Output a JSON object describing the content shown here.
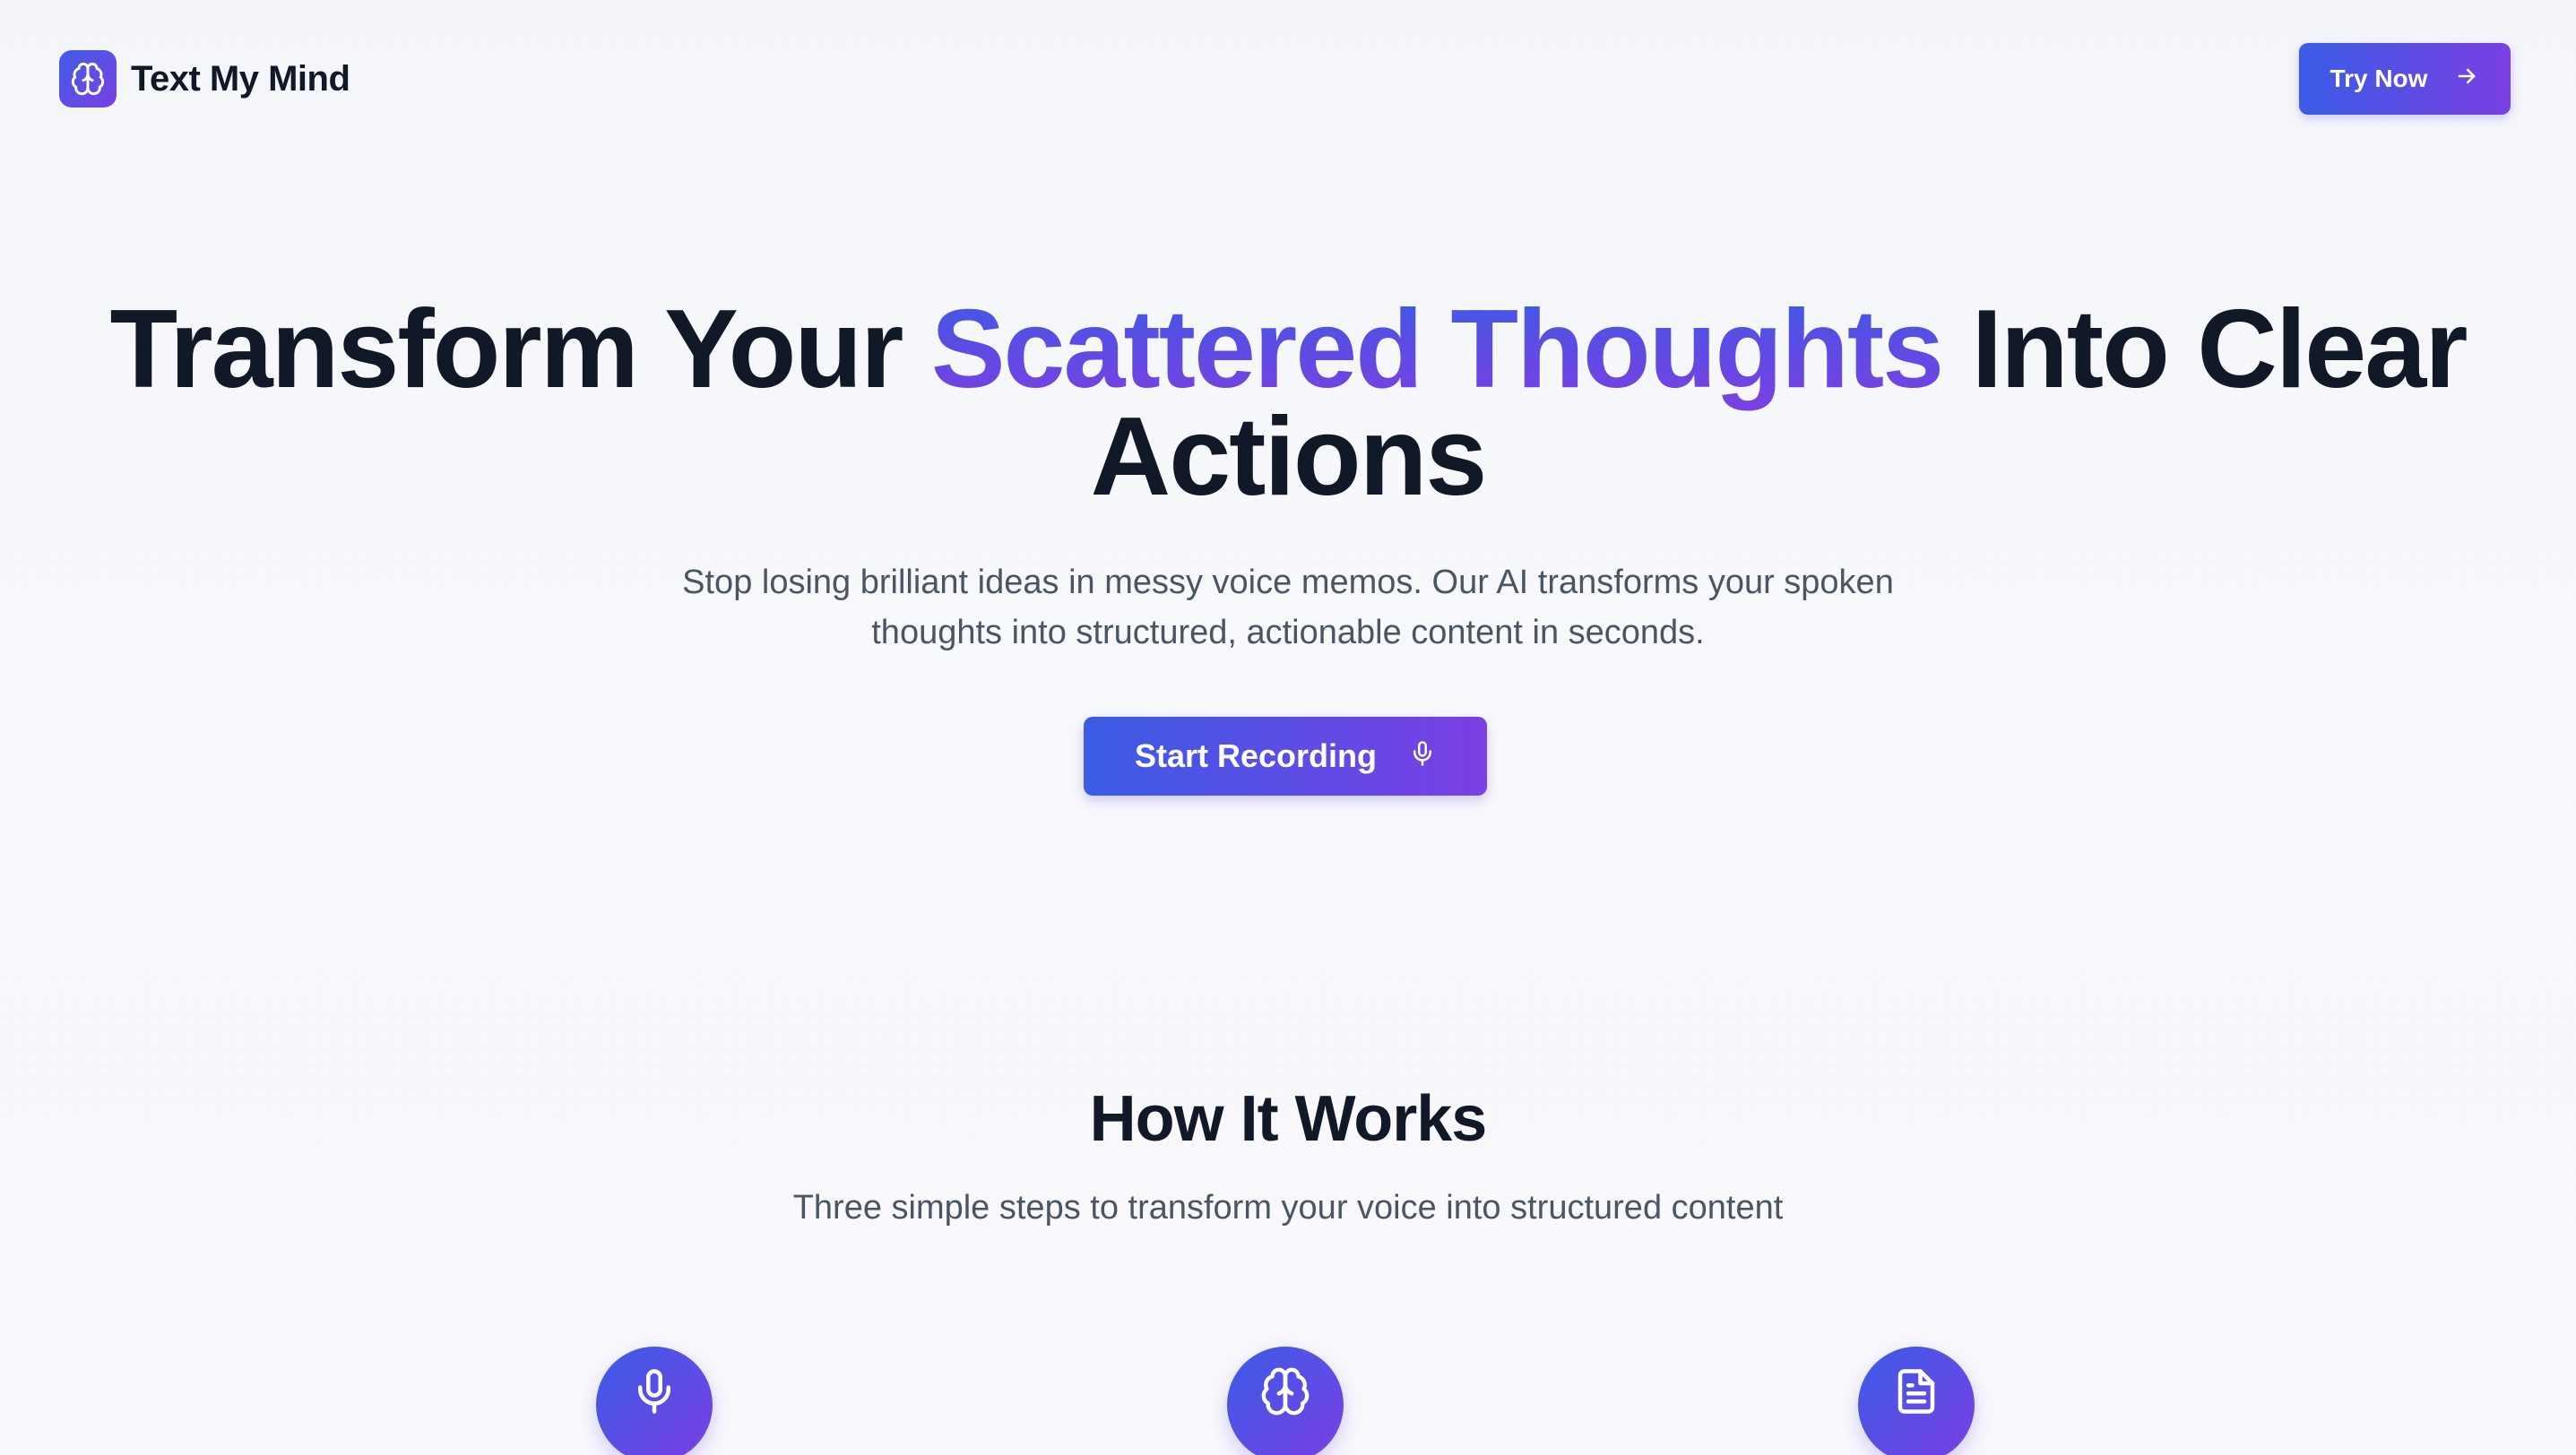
{
  "header": {
    "brand_name": "Text My Mind",
    "brand_icon": "brain-icon",
    "cta_label": "Try Now",
    "cta_icon": "arrow-right-icon"
  },
  "hero": {
    "title_part1": "Transform Your ",
    "title_highlight": "Scattered Thoughts",
    "title_part2": " Into Clear Actions",
    "subtitle": "Stop losing brilliant ideas in messy voice memos. Our AI transforms your spoken thoughts into structured, actionable content in seconds.",
    "button_label": "Start Recording",
    "button_icon": "microphone-icon"
  },
  "how_it_works": {
    "title": "How It Works",
    "subtitle": "Three simple steps to transform your voice into structured content",
    "step_icons": [
      "microphone-icon",
      "brain-icon",
      "document-icon"
    ]
  },
  "colors": {
    "accent_start": "#3b5ce6",
    "accent_end": "#7b3fe3",
    "heading": "#111827",
    "body_text": "#4b5563"
  }
}
